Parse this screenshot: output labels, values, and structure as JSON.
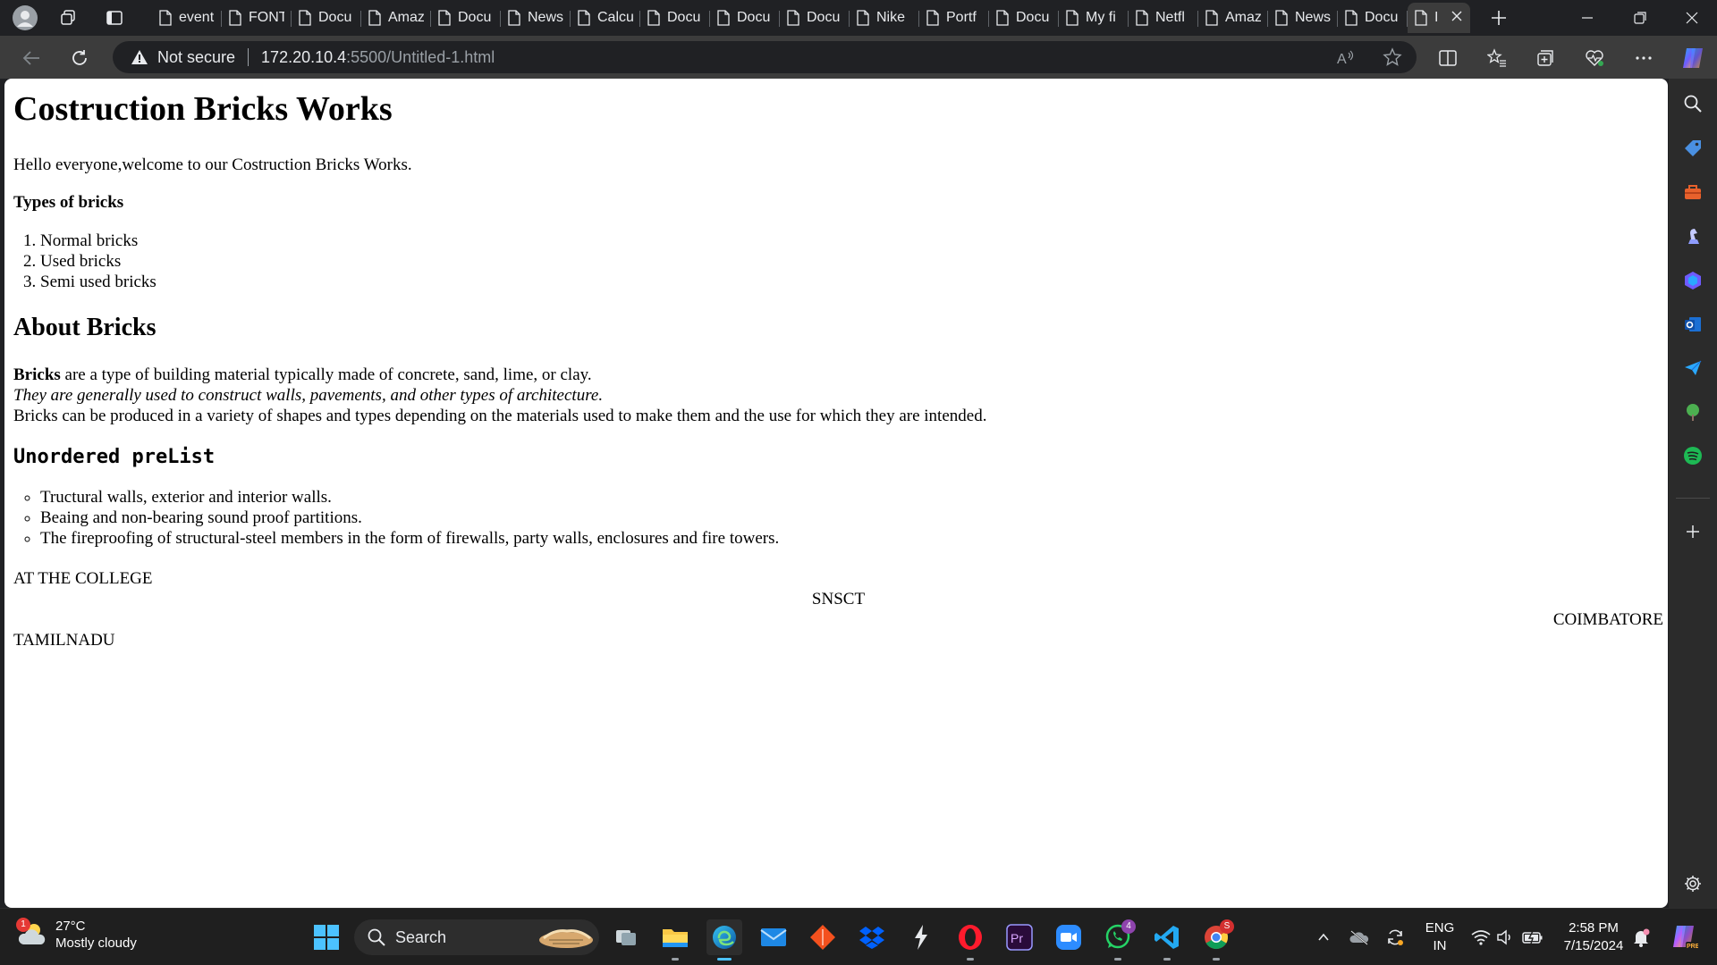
{
  "browser": {
    "tabs": [
      {
        "label": "event"
      },
      {
        "label": "FONT"
      },
      {
        "label": "Docu"
      },
      {
        "label": "Amaz"
      },
      {
        "label": "Docu"
      },
      {
        "label": "News"
      },
      {
        "label": "Calcu"
      },
      {
        "label": "Docu"
      },
      {
        "label": "Docu"
      },
      {
        "label": "Docu"
      },
      {
        "label": "Nike"
      },
      {
        "label": "Portf"
      },
      {
        "label": "Docu"
      },
      {
        "label": "My fi"
      },
      {
        "label": "Netfl"
      },
      {
        "label": "Amaz"
      },
      {
        "label": "News"
      },
      {
        "label": "Docu"
      },
      {
        "label": "I"
      }
    ],
    "new_tab_icon": "plus-icon",
    "security_label": "Not secure",
    "url_host": "172.20.10.4",
    "url_path": ":5500/Untitled-1.html"
  },
  "page": {
    "title": "Costruction Bricks Works",
    "intro": "Hello everyone,welcome to our Costruction Bricks Works.",
    "types_heading": "Types of bricks",
    "brick_types": [
      "Normal bricks",
      "Used bricks",
      "Semi used bricks"
    ],
    "about_heading": "About Bricks",
    "about_bold": "Bricks",
    "about_line1": " are a type of building material typically made of concrete, sand, lime, or clay.",
    "about_line2": "They are generally used to construct walls, pavements, and other types of architecture.",
    "about_line3": "Bricks can be produced in a variety of shapes and types depending on the materials used to make them and the use for which they are intended.",
    "list_heading": "Unordered preList",
    "uses": [
      "Tructural walls, exterior and interior walls.",
      "Beaing and non-bearing sound proof partitions.",
      "The fireproofing of structural-steel members in the form of firewalls, party walls, enclosures and fire towers."
    ],
    "footer_left": "AT THE COLLEGE",
    "footer_center": "SNSCT",
    "footer_right": "COIMBATORE",
    "footer_last": "TAMILNADU"
  },
  "taskbar": {
    "weather_temp": "27°C",
    "weather_desc": "Mostly cloudy",
    "weather_badge": "1",
    "search_label": "Search",
    "whatsapp_badge": "4",
    "chrome_badge": "S",
    "lang_top": "ENG",
    "lang_bottom": "IN",
    "time": "2:58 PM",
    "date": "7/15/2024"
  },
  "colors": {
    "tab_bg": "#202124",
    "toolbar_bg": "#3c3c3c",
    "page_bg": "#ffffff",
    "taskbar_bg": "#1f1f1f"
  }
}
